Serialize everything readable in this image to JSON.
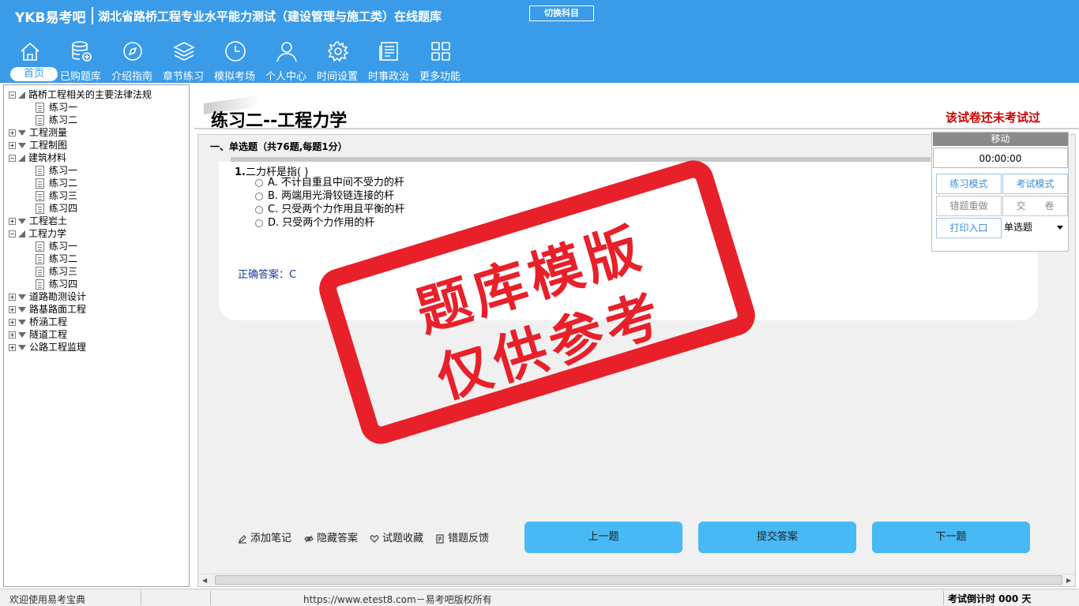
{
  "header": {
    "brand": "YKB易考吧",
    "title": "湖北省路桥工程专业水平能力测试（建设管理与施工类）在线题库",
    "switch_label": "切换科目"
  },
  "nav": [
    {
      "label": "首页",
      "icon": "home-icon"
    },
    {
      "label": "已购题库",
      "icon": "database-icon"
    },
    {
      "label": "介绍指南",
      "icon": "compass-icon"
    },
    {
      "label": "章节练习",
      "icon": "layers-icon"
    },
    {
      "label": "模拟考场",
      "icon": "clock-icon"
    },
    {
      "label": "个人中心",
      "icon": "user-icon"
    },
    {
      "label": "时间设置",
      "icon": "gear-icon"
    },
    {
      "label": "时事政治",
      "icon": "news-icon"
    },
    {
      "label": "更多功能",
      "icon": "grid-icon"
    }
  ],
  "tree": [
    {
      "label": "路桥工程相关的主要法律法规",
      "open": true,
      "children": [
        "练习一",
        "练习二"
      ]
    },
    {
      "label": "工程测量",
      "open": false
    },
    {
      "label": "工程制图",
      "open": false
    },
    {
      "label": "建筑材料",
      "open": true,
      "children": [
        "练习一",
        "练习二",
        "练习三",
        "练习四"
      ]
    },
    {
      "label": "工程岩土",
      "open": false
    },
    {
      "label": "工程力学",
      "open": true,
      "children": [
        "练习一",
        "练习二",
        "练习三",
        "练习四"
      ]
    },
    {
      "label": "道路勘测设计",
      "open": false
    },
    {
      "label": "路基路面工程",
      "open": false
    },
    {
      "label": "桥涵工程",
      "open": false
    },
    {
      "label": "隧道工程",
      "open": false
    },
    {
      "label": "公路工程监理",
      "open": false
    }
  ],
  "paper": {
    "title": "练习二--工程力学",
    "status": "该试卷还未考试过",
    "section": "一、单选题（共76题,每题1分）"
  },
  "question": {
    "number": "1.",
    "text": "二力杆是指( )",
    "options": [
      "A. 不计自重且中间不受力的杆",
      "B. 两端用光滑铰链连接的杆",
      "C. 只受两个力作用且平衡的杆",
      "D. 只受两个力作用的杆"
    ],
    "answer": "正确答案：C"
  },
  "stamp": {
    "line1": "题库模版",
    "line2": "仅供参考"
  },
  "widget": {
    "head": "移动",
    "timer": "00:00:00",
    "practice_mode": "练习模式",
    "exam_mode": "考试模式",
    "redo_wrong": "错题重做",
    "submit_paper": "交　　卷",
    "print": "打印入口",
    "qtype": "单选题"
  },
  "tools": {
    "note": "添加笔记",
    "hide_answer": "隐藏答案",
    "favorite": "试题收藏",
    "feedback": "错题反馈"
  },
  "buttons": {
    "prev": "上一题",
    "submit": "提交答案",
    "next": "下一题"
  },
  "statusbar": {
    "welcome": "欢迎使用易考宝典",
    "copyright": "https://www.etest8.com－易考吧版权所有",
    "countdown": "考试倒计时 000 天"
  },
  "colors": {
    "header": "#3a9be8",
    "button": "#47b9f4",
    "stamp": "#e8202a",
    "status": "#cc0000"
  }
}
